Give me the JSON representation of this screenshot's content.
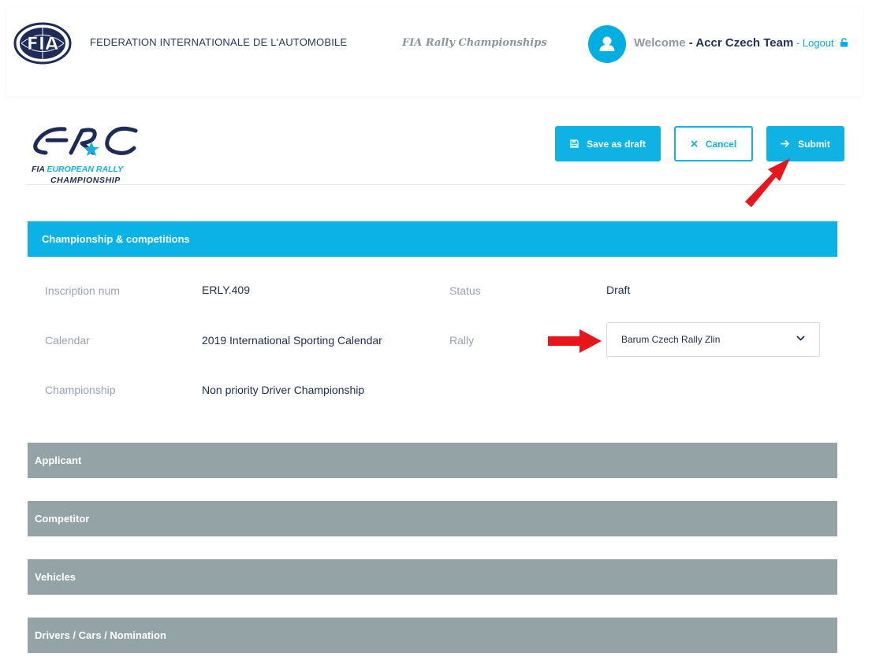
{
  "header": {
    "org_name": "FEDERATION INTERNATIONALE DE L'AUTOMOBILE",
    "logo_text": "FIA",
    "championships_link": "FIA Rally Championships",
    "welcome_label": "Welcome",
    "welcome_sep": " - ",
    "user_name": "Accr Czech Team",
    "logout_sep": " - ",
    "logout_label": "Logout"
  },
  "erc_logo": {
    "mark": "ERC",
    "line1_prefix": "FIA",
    "line1_highlight": "EUROPEAN RALLY",
    "line2": "CHAMPIONSHIP"
  },
  "toolbar": {
    "save_draft_label": "Save as draft",
    "cancel_label": "Cancel",
    "submit_label": "Submit"
  },
  "sections": {
    "championship": {
      "title": "Championship & competitions",
      "inscription_label": "Inscription num",
      "inscription_value": "ERLY.409",
      "status_label": "Status",
      "status_value": "Draft",
      "calendar_label": "Calendar",
      "calendar_value": "2019 International Sporting Calendar",
      "rally_label": "Rally",
      "rally_value": "Barum Czech Rally Zlin",
      "championship_label": "Championship",
      "championship_value": "Non priority Driver Championship"
    },
    "collapsed": [
      {
        "title": "Applicant"
      },
      {
        "title": "Competitor"
      },
      {
        "title": "Vehicles"
      },
      {
        "title": "Drivers / Cars / Nomination"
      }
    ]
  },
  "colors": {
    "accent": "#0fb3e3",
    "navy": "#23325a",
    "collapsed_section": "#94a3a6",
    "annotation_arrow": "#e8161b"
  }
}
